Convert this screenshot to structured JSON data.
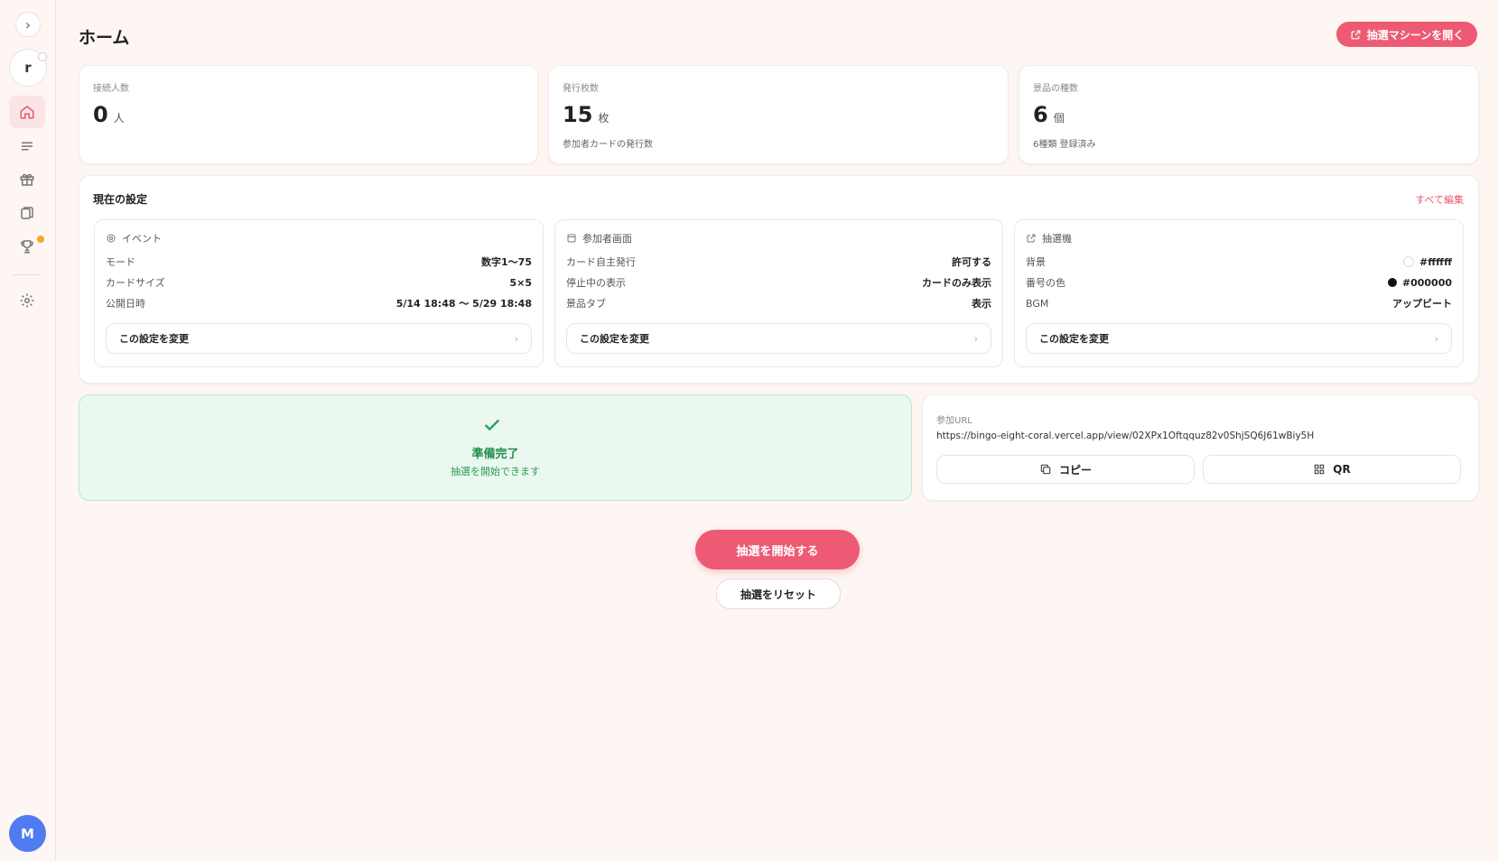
{
  "sidebar": {
    "toggle_glyph": "›",
    "room_initial": "r",
    "user_initial": "M",
    "items": [
      {
        "icon": "home-icon",
        "active": true
      },
      {
        "icon": "list-icon",
        "active": false
      },
      {
        "icon": "gift-icon",
        "active": false
      },
      {
        "icon": "cards-icon",
        "active": false
      },
      {
        "icon": "trophy-icon",
        "active": false,
        "badge": true
      },
      {
        "icon": "gear-icon",
        "active": false
      }
    ]
  },
  "header": {
    "title": "ホーム",
    "open_machine_label": "抽選マシーンを開く"
  },
  "stats": [
    {
      "label": "接続人数",
      "value": "0",
      "unit": "人",
      "sub": ""
    },
    {
      "label": "発行枚数",
      "value": "15",
      "unit": "枚",
      "sub": "参加者カードの発行数"
    },
    {
      "label": "景品の種数",
      "value": "6",
      "unit": "個",
      "sub": "6種類 登録済み"
    }
  ],
  "settings": {
    "title": "現在の設定",
    "edit_all_label": "すべて編集",
    "change_label": "この設定を変更",
    "event": {
      "title": "イベント",
      "rows": [
        {
          "key": "モード",
          "value": "数字1〜75"
        },
        {
          "key": "カードサイズ",
          "value": "5×5"
        },
        {
          "key": "公開日時",
          "value": "5/14 18:48 〜 5/29 18:48"
        }
      ]
    },
    "participant": {
      "title": "参加者画面",
      "rows": [
        {
          "key": "カード自主発行",
          "value": "許可する"
        },
        {
          "key": "停止中の表示",
          "value": "カードのみ表示"
        },
        {
          "key": "景品タブ",
          "value": "表示"
        }
      ]
    },
    "machine": {
      "title": "抽選機",
      "rows": [
        {
          "key": "背景",
          "value": "#ffffff",
          "swatch": "#ffffff"
        },
        {
          "key": "番号の色",
          "value": "#000000",
          "swatch": "#111111"
        },
        {
          "key": "BGM",
          "value": "アップビート"
        }
      ]
    }
  },
  "ready": {
    "title": "準備完了",
    "subtitle": "抽選を開始できます"
  },
  "join": {
    "label": "参加URL",
    "url": "https://bingo-eight-coral.vercel.app/view/02XPx1Oftqquz82v0ShjSQ6J61wBiy5H",
    "copy_label": "コピー",
    "qr_label": "QR"
  },
  "actions": {
    "start_label": "抽選を開始する",
    "reset_label": "抽選をリセット"
  },
  "colors": {
    "accent": "#ee5a74",
    "ready_green": "#1f8d4b",
    "background": "#fdf6f2"
  }
}
